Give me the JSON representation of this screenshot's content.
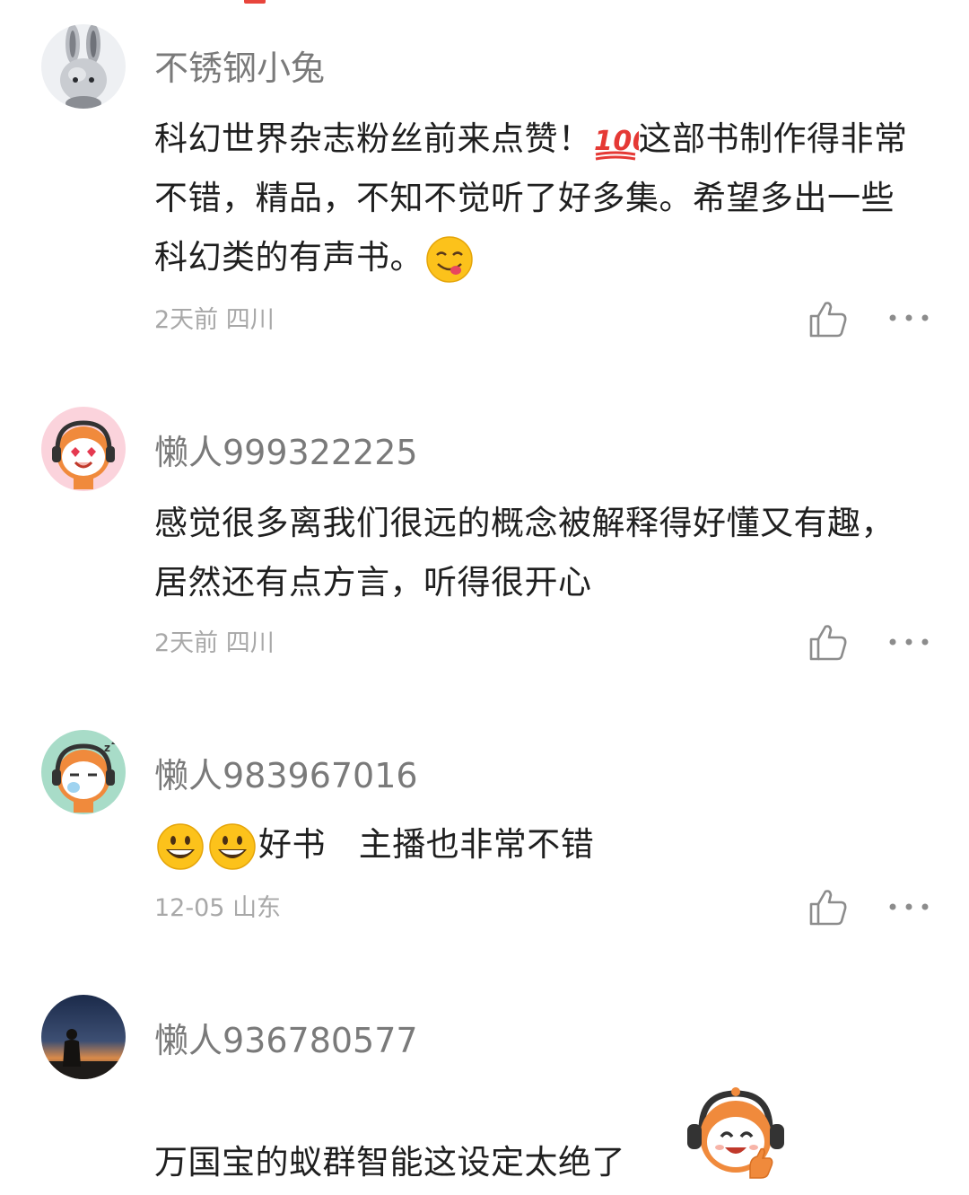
{
  "comments": [
    {
      "username": "不锈钢小兔",
      "text_a": "科幻世界杂志粉丝前来点赞！",
      "emoji_a": "hundred-points-icon",
      "text_b": "这部书制作得非常不错，精品，不知不觉听了好多集。希望多出一些科幻类的有声书。",
      "emoji_b": "savoring-face-icon",
      "time": "2天前",
      "location": "四川"
    },
    {
      "username": "懒人999322225",
      "text": "感觉很多离我们很远的概念被解释得好懂又有趣，居然还有点方言，听得很开心",
      "time": "2天前",
      "location": "四川"
    },
    {
      "username": "懒人983967016",
      "emoji": "grinning-face-icon",
      "text": "好书   主播也非常不错",
      "time": "12-05",
      "location": "山东"
    },
    {
      "username": "懒人936780577",
      "text": "万国宝的蚁群智能这设定太绝了",
      "sticker": "mascot-thumbs-up-sticker"
    }
  ],
  "colors": {
    "username": "#7a7a7a",
    "body": "#1f1f1f",
    "meta": "#a8a8a8",
    "icon": "#8c8c8c",
    "mascot": "#f08a3c"
  }
}
